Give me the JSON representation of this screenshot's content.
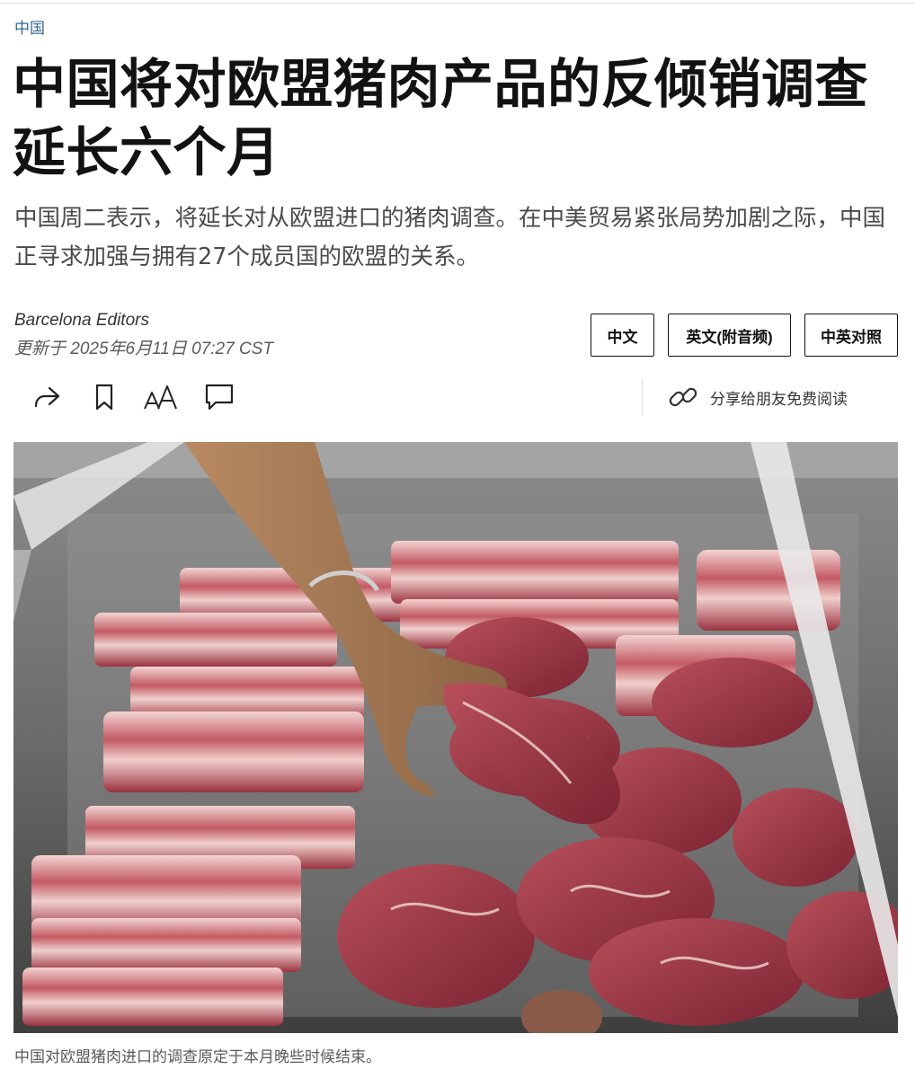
{
  "section": "中国",
  "headline": "中国将对欧盟猪肉产品的反倾销调查延长六个月",
  "summary": "中国周二表示，将延长对从欧盟进口的猪肉调查。在中美贸易紧张局势加剧之际，中国正寻求加强与拥有27个成员国的欧盟的关系。",
  "byline": "Barcelona Editors",
  "updated": "更新于 2025年6月11日 07:27 CST",
  "language_buttons": [
    "中文",
    "英文(附音频)",
    "中英对照"
  ],
  "toolbar": {
    "icons": [
      "share-icon",
      "bookmark-icon",
      "font-size-icon",
      "comment-icon"
    ],
    "gift_icon": "link-icon",
    "gift_label": "分享给朋友免费阅读"
  },
  "photo": {
    "caption": "中国对欧盟猪肉进口的调查原定于本月晚些时候结束。"
  }
}
